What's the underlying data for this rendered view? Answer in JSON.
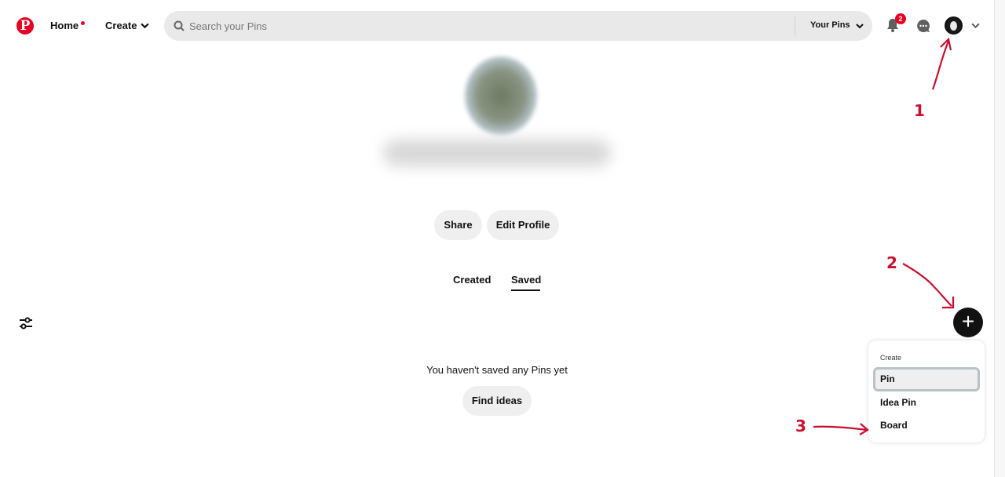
{
  "nav": {
    "home_label": "Home",
    "create_label": "Create"
  },
  "search": {
    "placeholder": "Search your Pins",
    "scope_label": "Your Pins"
  },
  "notifications": {
    "badge_count": "2"
  },
  "profile": {
    "share_label": "Share",
    "edit_label": "Edit Profile"
  },
  "tabs": [
    {
      "label": "Created"
    },
    {
      "label": "Saved"
    }
  ],
  "empty_state": {
    "message": "You haven't saved any Pins yet",
    "button_label": "Find ideas"
  },
  "fab": {
    "label": "+"
  },
  "create_menu": {
    "title": "Create",
    "items": [
      {
        "label": "Pin"
      },
      {
        "label": "Idea Pin"
      },
      {
        "label": "Board"
      }
    ]
  },
  "annotations": [
    "1",
    "2",
    "3"
  ],
  "colors": {
    "brand": "#e60023",
    "annotation": "#c8102e"
  }
}
